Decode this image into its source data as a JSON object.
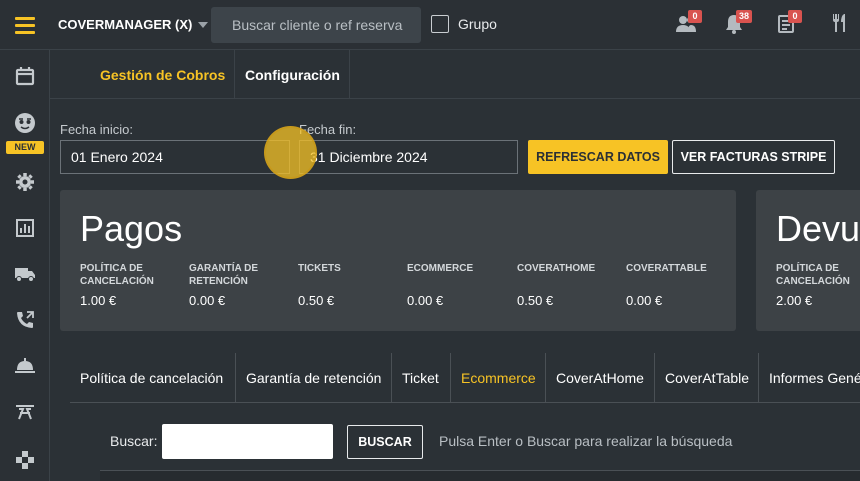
{
  "topbar": {
    "brand": "COVERMANAGER (X)",
    "search_placeholder": "Buscar cliente o ref reserva",
    "group_label": "Grupo",
    "badges": {
      "users": "0",
      "notifications": "38",
      "tasks": "0"
    }
  },
  "sidebar": {
    "new_badge": "NEW",
    "items": [
      "calendar-icon",
      "smiley-icon",
      "gear-icon",
      "chart-icon",
      "truck-icon",
      "phone-icon",
      "bell-icon",
      "table-icon",
      "gamepad-icon"
    ]
  },
  "subnav": {
    "tab_cobros": "Gestión de Cobros",
    "tab_config": "Configuración"
  },
  "filters": {
    "start_label": "Fecha inicio:",
    "start_value": "01 Enero 2024",
    "end_label": "Fecha fin:",
    "end_value": "31 Diciembre 2024",
    "refresh_button": "REFRESCAR DATOS",
    "stripe_button": "VER FACTURAS STRIPE"
  },
  "pagos": {
    "title": "Pagos",
    "stats": [
      {
        "label": "POLÍTICA DE CANCELACIÓN",
        "value": "1.00 €"
      },
      {
        "label": "GARANTÍA DE RETENCIÓN",
        "value": "0.00 €"
      },
      {
        "label": "TICKETS",
        "value": "0.50 €"
      },
      {
        "label": "ECOMMERCE",
        "value": "0.00 €"
      },
      {
        "label": "COVERATHOME",
        "value": "0.50 €"
      },
      {
        "label": "COVERATTABLE",
        "value": "0.00 €"
      }
    ]
  },
  "devoluciones": {
    "title": "Devu",
    "stats": [
      {
        "label": "POLÍTICA DE CANCELACIÓN",
        "value": "2.00 €"
      }
    ]
  },
  "tabs": [
    "Política de cancelación",
    "Garantía de retención",
    "Ticket",
    "Ecommerce",
    "CoverAtHome",
    "CoverAtTable",
    "Informes Gené"
  ],
  "search": {
    "label": "Buscar:",
    "button": "BUSCAR",
    "hint": "Pulsa Enter o Buscar para realizar la búsqueda"
  },
  "colors": {
    "accent": "#f7c325",
    "background": "#2b3136",
    "card": "#3d4246",
    "badge": "#d9534f"
  }
}
